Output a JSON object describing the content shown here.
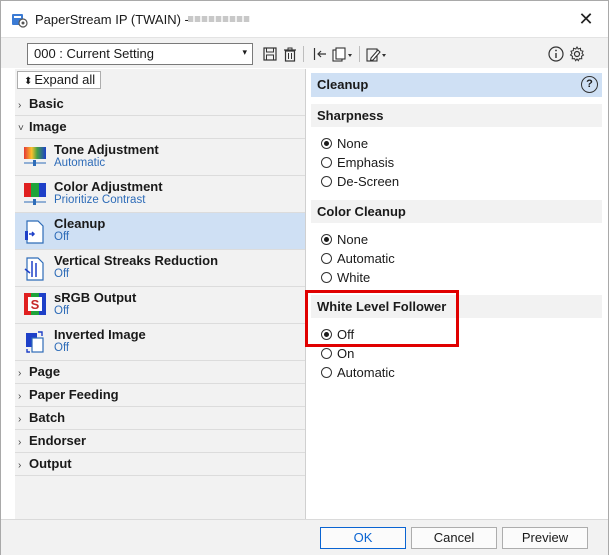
{
  "window": {
    "title": "PaperStream IP (TWAIN) -",
    "close_glyph": "✕"
  },
  "toolbar": {
    "setting_value": "000 : Current Setting",
    "caret": "▾",
    "icons": [
      "save-icon",
      "delete-icon",
      "undo-icon",
      "copy-settings-icon",
      "edit-settings-icon",
      "info-icon",
      "settings-gear-icon"
    ]
  },
  "left": {
    "expand_all_label": "Expand all",
    "groups_top": [
      {
        "chevron": "›",
        "label": "Basic"
      },
      {
        "chevron": "˅",
        "label": "Image"
      }
    ],
    "items": [
      {
        "name": "Tone Adjustment",
        "value": "Automatic"
      },
      {
        "name": "Color Adjustment",
        "value": "Prioritize Contrast"
      },
      {
        "name": "Cleanup",
        "value": "Off"
      },
      {
        "name": "Vertical Streaks Reduction",
        "value": "Off"
      },
      {
        "name": "sRGB Output",
        "value": "Off"
      },
      {
        "name": "Inverted Image",
        "value": "Off"
      }
    ],
    "srgb_icon_letter": "S",
    "groups_bottom": [
      {
        "chevron": "›",
        "label": "Page"
      },
      {
        "chevron": "›",
        "label": "Paper Feeding"
      },
      {
        "chevron": "›",
        "label": "Batch"
      },
      {
        "chevron": "›",
        "label": "Endorser"
      },
      {
        "chevron": "›",
        "label": "Output"
      }
    ]
  },
  "right": {
    "header": "Cleanup",
    "help_glyph": "?",
    "sections": [
      {
        "title": "Sharpness",
        "options": [
          "None",
          "Emphasis",
          "De-Screen"
        ],
        "selected": 0
      },
      {
        "title": "Color Cleanup",
        "options": [
          "None",
          "Automatic",
          "White"
        ],
        "selected": 0
      },
      {
        "title": "White Level Follower",
        "options": [
          "Off",
          "On",
          "Automatic"
        ],
        "selected": 0
      }
    ]
  },
  "footer": {
    "ok_label": "OK",
    "cancel_label": "Cancel",
    "preview_label": "Preview"
  },
  "colors": {
    "selection": "#cfe0f4",
    "highlight": "#e00000",
    "link_blue": "#2e6cb8",
    "primary_border": "#0a64d2"
  }
}
